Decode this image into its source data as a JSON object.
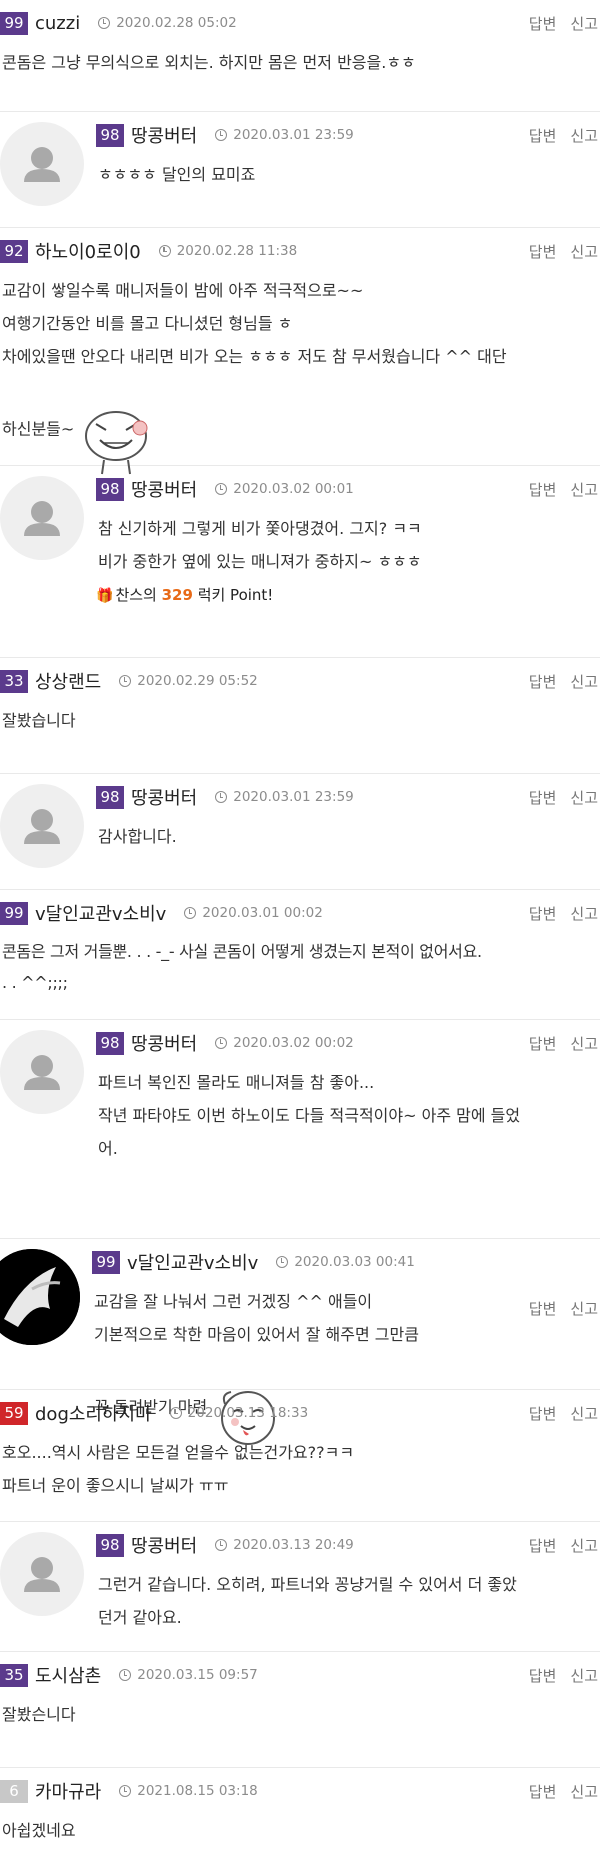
{
  "actions": {
    "reply": "답변",
    "report": "신고"
  },
  "comments": [
    {
      "level": "99",
      "level_color": "#5b3a8c",
      "nick": "cuzzi",
      "date": "2020.02.28 05:02",
      "text": "콘돔은 그냥 무의식으로 외치는. 하지만 몸은 먼저 반응을.ㅎㅎ"
    },
    {
      "level": "98",
      "level_color": "#5b3a8c",
      "nick": "땅콩버터",
      "date": "2020.03.01 23:59",
      "text": "ㅎㅎㅎㅎ 달인의 묘미죠"
    },
    {
      "level": "92",
      "level_color": "#5b3a8c",
      "nick": "하노이0로이0",
      "date": "2020.02.28 11:38",
      "text": "교감이 쌓일수록 매니저들이 밤에 아주 적극적으로~~\n여행기간동안 비를 몰고 다니셨던 형님들 ㅎ\n차에있을땐 안오다 내리면 비가 오는 ㅎㅎㅎ 저도 참 무서웠습니다 ^^ 대단\n하신분들~"
    },
    {
      "level": "98",
      "level_color": "#5b3a8c",
      "nick": "땅콩버터",
      "date": "2020.03.02 00:01",
      "text": "참 신기하게 그렇게 비가 쫓아댕겼어. 그지? ㅋㅋ\n비가 중한가 옆에 있는 매니져가 중하지~ ㅎㅎㅎ",
      "point_prefix": "찬스의 ",
      "point_value": "329",
      "point_suffix": " 럭키 Point!"
    },
    {
      "level": "33",
      "level_color": "#5b3a8c",
      "nick": "상상랜드",
      "date": "2020.02.29 05:52",
      "text": "잘봤습니다"
    },
    {
      "level": "98",
      "level_color": "#5b3a8c",
      "nick": "땅콩버터",
      "date": "2020.03.01 23:59",
      "text": "감사합니다."
    },
    {
      "level": "99",
      "level_color": "#5b3a8c",
      "nick": "v달인교관v소비v",
      "date": "2020.03.01 00:02",
      "text": "콘돔은 그저 거들뿐. . . -_- 사실 콘돔이 어떻게 생겼는지 본적이 없어서요.\n. . ^^;;;;"
    },
    {
      "level": "98",
      "level_color": "#5b3a8c",
      "nick": "땅콩버터",
      "date": "2020.03.02 00:02",
      "text": "파트너 복인진 몰라도 매니져들 참 좋아...\n작년 파타야도 이번 하노이도 다들 적극적이야~ 아주 맘에 들었\n어."
    },
    {
      "level": "99",
      "level_color": "#5b3a8c",
      "nick": "v달인교관v소비v",
      "date": "2020.03.03 00:41",
      "text": "교감을 잘 나눠서 그런 거겠징 ^^ 애들이\n기본적으로 착한 마음이 있어서 잘 해주면 그만큼\n꼭 돌려받기 마련"
    },
    {
      "level": "59",
      "level_color": "#d0262a",
      "nick": "dog소리하지마",
      "date": "2020.03.13 18:33",
      "text": "호오....역시 사람은 모든걸 얻을수 없는건가요??ㅋㅋ\n파트너 운이 좋으시니 날씨가 ㅠㅠ"
    },
    {
      "level": "98",
      "level_color": "#5b3a8c",
      "nick": "땅콩버터",
      "date": "2020.03.13 20:49",
      "text": "그런거 같습니다. 오히려, 파트너와 꽁냥거릴 수 있어서 더 좋았\n던거 같아요."
    },
    {
      "level": "35",
      "level_color": "#5b3a8c",
      "nick": "도시삼촌",
      "date": "2020.03.15 09:57",
      "text": "잘봤슨니다"
    },
    {
      "level": "6",
      "level_color": "#c8c8c8",
      "nick": "카마규라",
      "date": "2021.08.15 03:18",
      "text": "아쉽겠네요"
    }
  ]
}
